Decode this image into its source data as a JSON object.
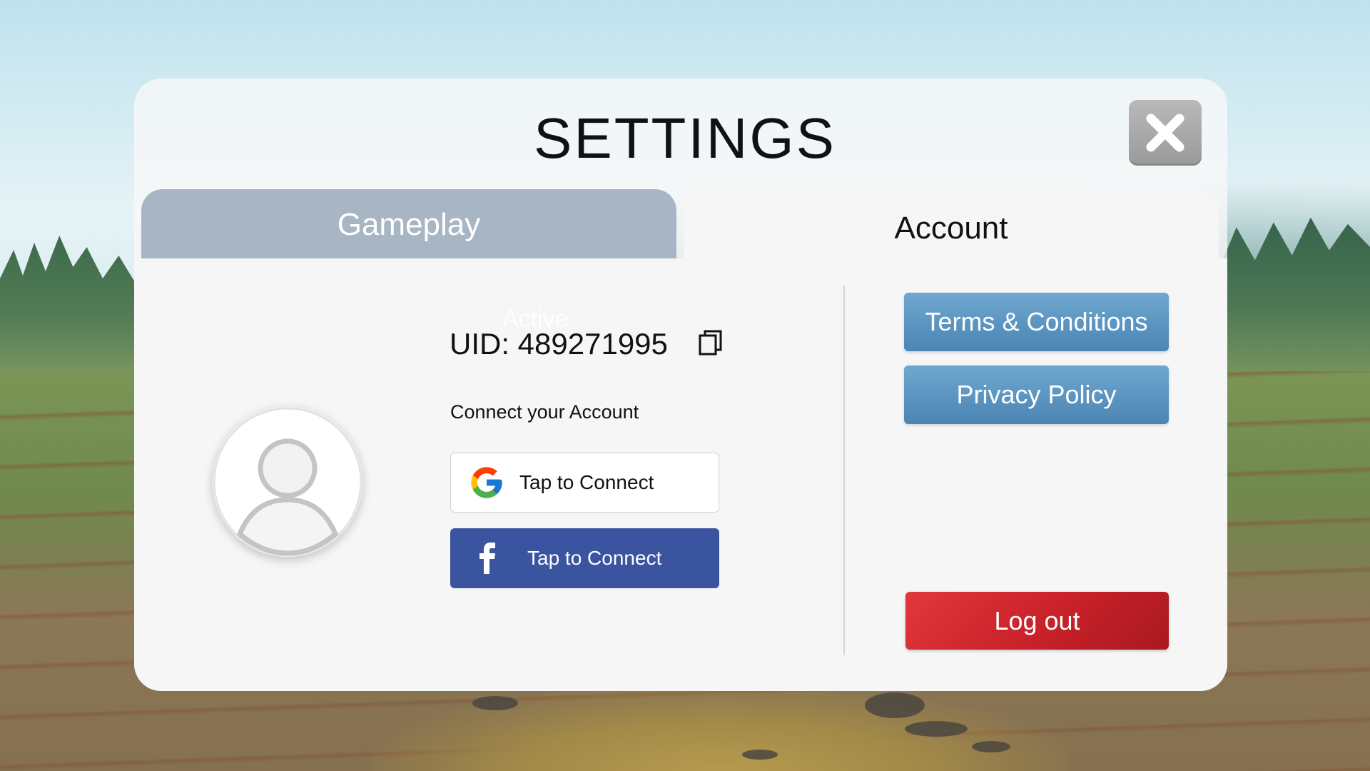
{
  "header": {
    "title": "SETTINGS",
    "close_icon": "close-x-icon"
  },
  "tabs": [
    {
      "label": "Gameplay",
      "selected": false
    },
    {
      "label": "Account",
      "selected": true
    }
  ],
  "account": {
    "ghost_text": "Active",
    "uid_text": "UID: 489271995",
    "copy_icon": "copy-icon",
    "connect_label": "Connect your Account",
    "google_button": {
      "label": "Tap to Connect",
      "icon": "google-icon"
    },
    "facebook_button": {
      "label": "Tap to Connect",
      "icon": "facebook-icon",
      "color": "#3a54a0"
    },
    "avatar_icon": "user-avatar-icon"
  },
  "links": {
    "terms": "Terms & Conditions",
    "privacy": "Privacy Policy"
  },
  "logout_label": "Log out",
  "colors": {
    "tab_inactive": "#a7b5c4",
    "link_button": "#5b95c1",
    "logout": "#d42a31"
  }
}
